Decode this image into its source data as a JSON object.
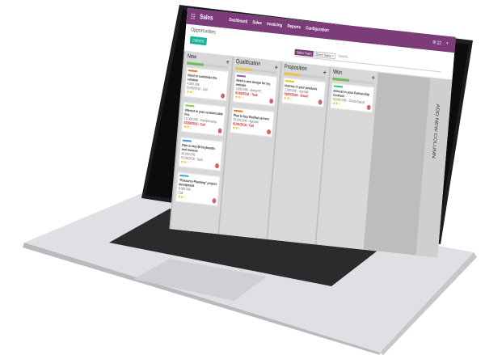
{
  "app": {
    "brand": "Sales",
    "menu": [
      "Dashboard",
      "Sales",
      "Invoicing",
      "Reports",
      "Configuration"
    ],
    "notif": "22"
  },
  "control": {
    "breadcrumb": "Opportunities",
    "create": "CREATE",
    "facet_label": "Sales Team",
    "facet_value": "Direct Sales",
    "facet_x": "×",
    "search_placeholder": "Search..."
  },
  "columns": [
    {
      "name": "New",
      "bar": "#6fbd5a",
      "cards": [
        {
          "title": "Need to customize the solution",
          "amount": "4,500.00€",
          "line": "01/05/2016 : Call",
          "tag": "#e67e22"
        },
        {
          "title": "Interest in your customizable Pcs",
          "amount": "15,000.00€ - Camptocamp",
          "date": "01/08/2016 : Call",
          "tag": "#8ad04f"
        },
        {
          "title": "Plan to buy 60 keyboards and mouses",
          "amount": "40,000.00€",
          "line": "01/05/2016 : Task",
          "tag": "#4a90e2"
        },
        {
          "title": "\"Resource Planning\" project develpment",
          "amount": "9,000.00€",
          "line": "Call",
          "tag": "#3fa7d6"
        }
      ]
    },
    {
      "name": "Qualification",
      "bar": "#e7c44f",
      "cards": [
        {
          "title": "Need a new design for my website",
          "amount": "3,800.00€ - Delta PC",
          "date": "01/02/2016 : Task",
          "tag": "#9b59b6"
        },
        {
          "title": "Plan to buy RedHat servers",
          "amount": "25,000.00€ - Agrolait",
          "date": "01/01/2016 : Call",
          "tag": "#e67e22"
        }
      ]
    },
    {
      "name": "Proposition",
      "bar": "#e7c44f",
      "cards": [
        {
          "title": "Interest in your products",
          "amount": "2,000.00€ - Agrolait",
          "date": "01/03/2016 : Email",
          "tag": "#f1c40f"
        }
      ]
    },
    {
      "name": "Won",
      "bar": "#6fbd5a",
      "cards": [
        {
          "title": "Interest in your Partnership Contract",
          "amount": "15,600.00€ - China Export",
          "line": "",
          "tag": "#2ecc71"
        }
      ]
    }
  ],
  "add_column": "ADD NEW COLUMN"
}
